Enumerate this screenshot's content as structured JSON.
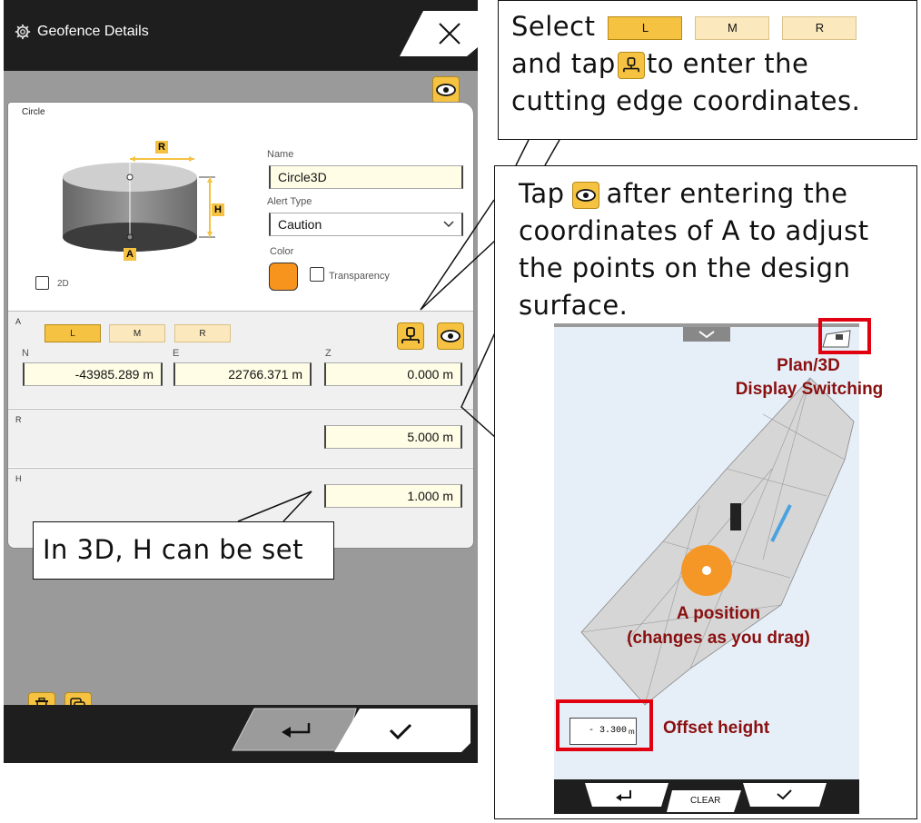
{
  "app": {
    "title": "Geofence Details"
  },
  "shape": {
    "label": "Circle"
  },
  "diagram": {
    "r_label": "R",
    "h_label": "H",
    "a_label": "A"
  },
  "name_field": {
    "label": "Name",
    "value": "Circle3D"
  },
  "alert_field": {
    "label": "Alert Type",
    "value": "Caution"
  },
  "color_field": {
    "label": "Color",
    "swatch": "#f7941d"
  },
  "transparency": {
    "label": "Transparency"
  },
  "two_d": {
    "label": "2D"
  },
  "section_a": {
    "label": "A",
    "buttons": [
      "L",
      "M",
      "R"
    ],
    "n_label": "N",
    "e_label": "E",
    "z_label": "Z",
    "n_value": "-43985.289 m",
    "e_value": "22766.371 m",
    "z_value": "0.000 m"
  },
  "section_r": {
    "label": "R",
    "value": "5.000 m"
  },
  "section_h": {
    "label": "H",
    "value": "1.000 m"
  },
  "callouts": {
    "c1_select": "Select",
    "c1_l": "L",
    "c1_m": "M",
    "c1_r": "R",
    "c1_tap1": "and tap",
    "c1_tap2": "to enter the",
    "c1_line3": "cutting edge coordinates.",
    "c2_tap": "Tap",
    "c2_line1": "after entering the",
    "c2_line2": "coordinates of A to adjust",
    "c2_line3": "the points on the design",
    "c2_line4": "surface.",
    "c3": "In 3D, H can be set"
  },
  "phone": {
    "plan3d_line1": "Plan/3D",
    "plan3d_line2": "Display Switching",
    "a_position_line1": "A position",
    "a_position_line2": "(changes as you drag)",
    "offset_label": "Offset height",
    "offset_value": "- 3.300",
    "offset_unit": "m",
    "clear_label": "CLEAR"
  },
  "colors": {
    "accent": "#f5c242",
    "highlight": "#e0000f",
    "annotation": "#8a1010"
  }
}
